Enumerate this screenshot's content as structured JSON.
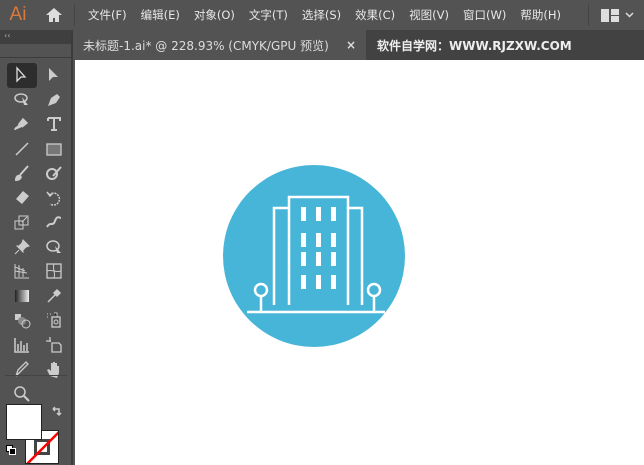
{
  "app": {
    "logo": "Ai"
  },
  "menu": [
    "文件(F)",
    "编辑(E)",
    "对象(O)",
    "文字(T)",
    "选择(S)",
    "效果(C)",
    "视图(V)",
    "窗口(W)",
    "帮助(H)"
  ],
  "tabs": {
    "active": "未标题-1.ai* @ 228.93% (CMYK/GPU 预览)",
    "close": "×",
    "watermark": "软件自学网：WWW.RJZXW.COM"
  },
  "toolbar": {
    "collapse": "‹‹"
  },
  "colors": {
    "accent": "#47b5d8",
    "stroke_none": "#ff0000"
  },
  "artwork": {
    "icon": "building-icon"
  }
}
